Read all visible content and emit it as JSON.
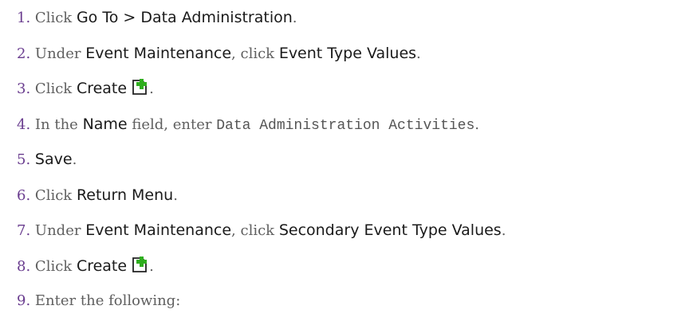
{
  "steps": [
    {
      "n": "1.",
      "a": "Click",
      "b": "Go To > Data Administration",
      "c": "."
    },
    {
      "n": "2.",
      "a": "Under",
      "b": "Event Maintenance",
      "c": ", click",
      "d": "Event Type Values",
      "e": "."
    },
    {
      "n": "3.",
      "a": "Click",
      "b": "Create",
      "icon": "create-plus-icon",
      "c": "."
    },
    {
      "n": "4.",
      "a": "In the",
      "b": "Name",
      "c": "field, enter",
      "d": "Data Administration Activities",
      "e": "."
    },
    {
      "n": "5.",
      "b": "Save",
      "c": "."
    },
    {
      "n": "6.",
      "a": "Click",
      "b": "Return Menu",
      "c": "."
    },
    {
      "n": "7.",
      "a": "Under",
      "b": "Event Maintenance",
      "c": ", click",
      "d": "Secondary Event Type Values",
      "e": "."
    },
    {
      "n": "8.",
      "a": "Click",
      "b": "Create",
      "icon": "create-plus-icon",
      "c": "."
    },
    {
      "n": "9.",
      "a": "Enter the following:"
    }
  ],
  "icon_colors": {
    "plus": "#2fae1e",
    "page": "#222222"
  }
}
